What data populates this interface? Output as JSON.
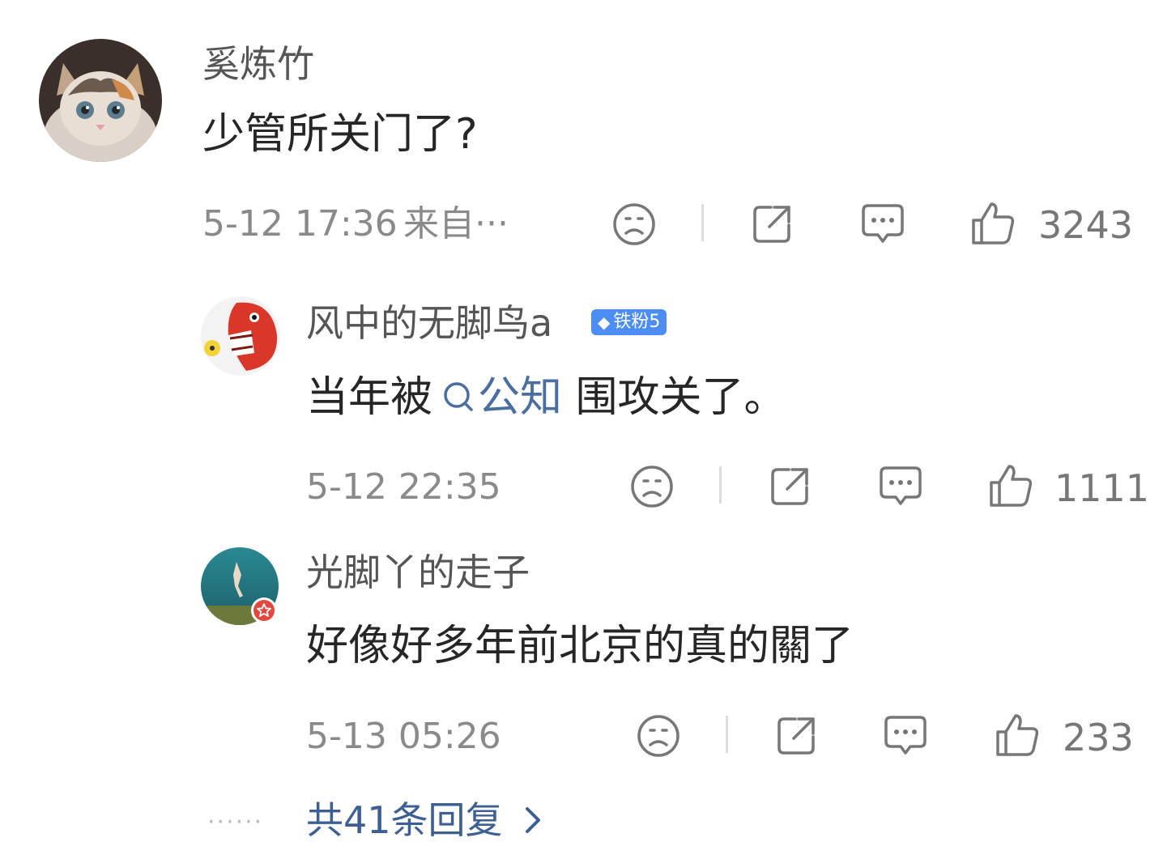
{
  "comment": {
    "username": "奚炼竹",
    "text": "少管所关门了?",
    "time": "5-12 17:36",
    "source": "来自···",
    "likes": "3243"
  },
  "replies": [
    {
      "username": "风中的无脚鸟a",
      "badge": "铁粉5",
      "text_before": "当年被",
      "topic_link": "公知",
      "text_after": " 围攻关了。",
      "time": "5-12 22:35",
      "likes": "1111"
    },
    {
      "username": "光脚丫的走子",
      "text": "好像好多年前北京的真的關了",
      "time": "5-13 05:26",
      "likes": "233"
    }
  ],
  "more_replies": {
    "dots": "······",
    "label": "共41条回复"
  },
  "icons": {
    "dislike": "frown-icon",
    "share": "share-icon",
    "reply": "comment-icon",
    "like": "thumbs-up-icon",
    "more": "chevron-right-icon",
    "topic": "search-icon"
  },
  "colors": {
    "link": "#4a6ea0",
    "badge": "#4b8df2",
    "meta": "#8a8a8a"
  }
}
